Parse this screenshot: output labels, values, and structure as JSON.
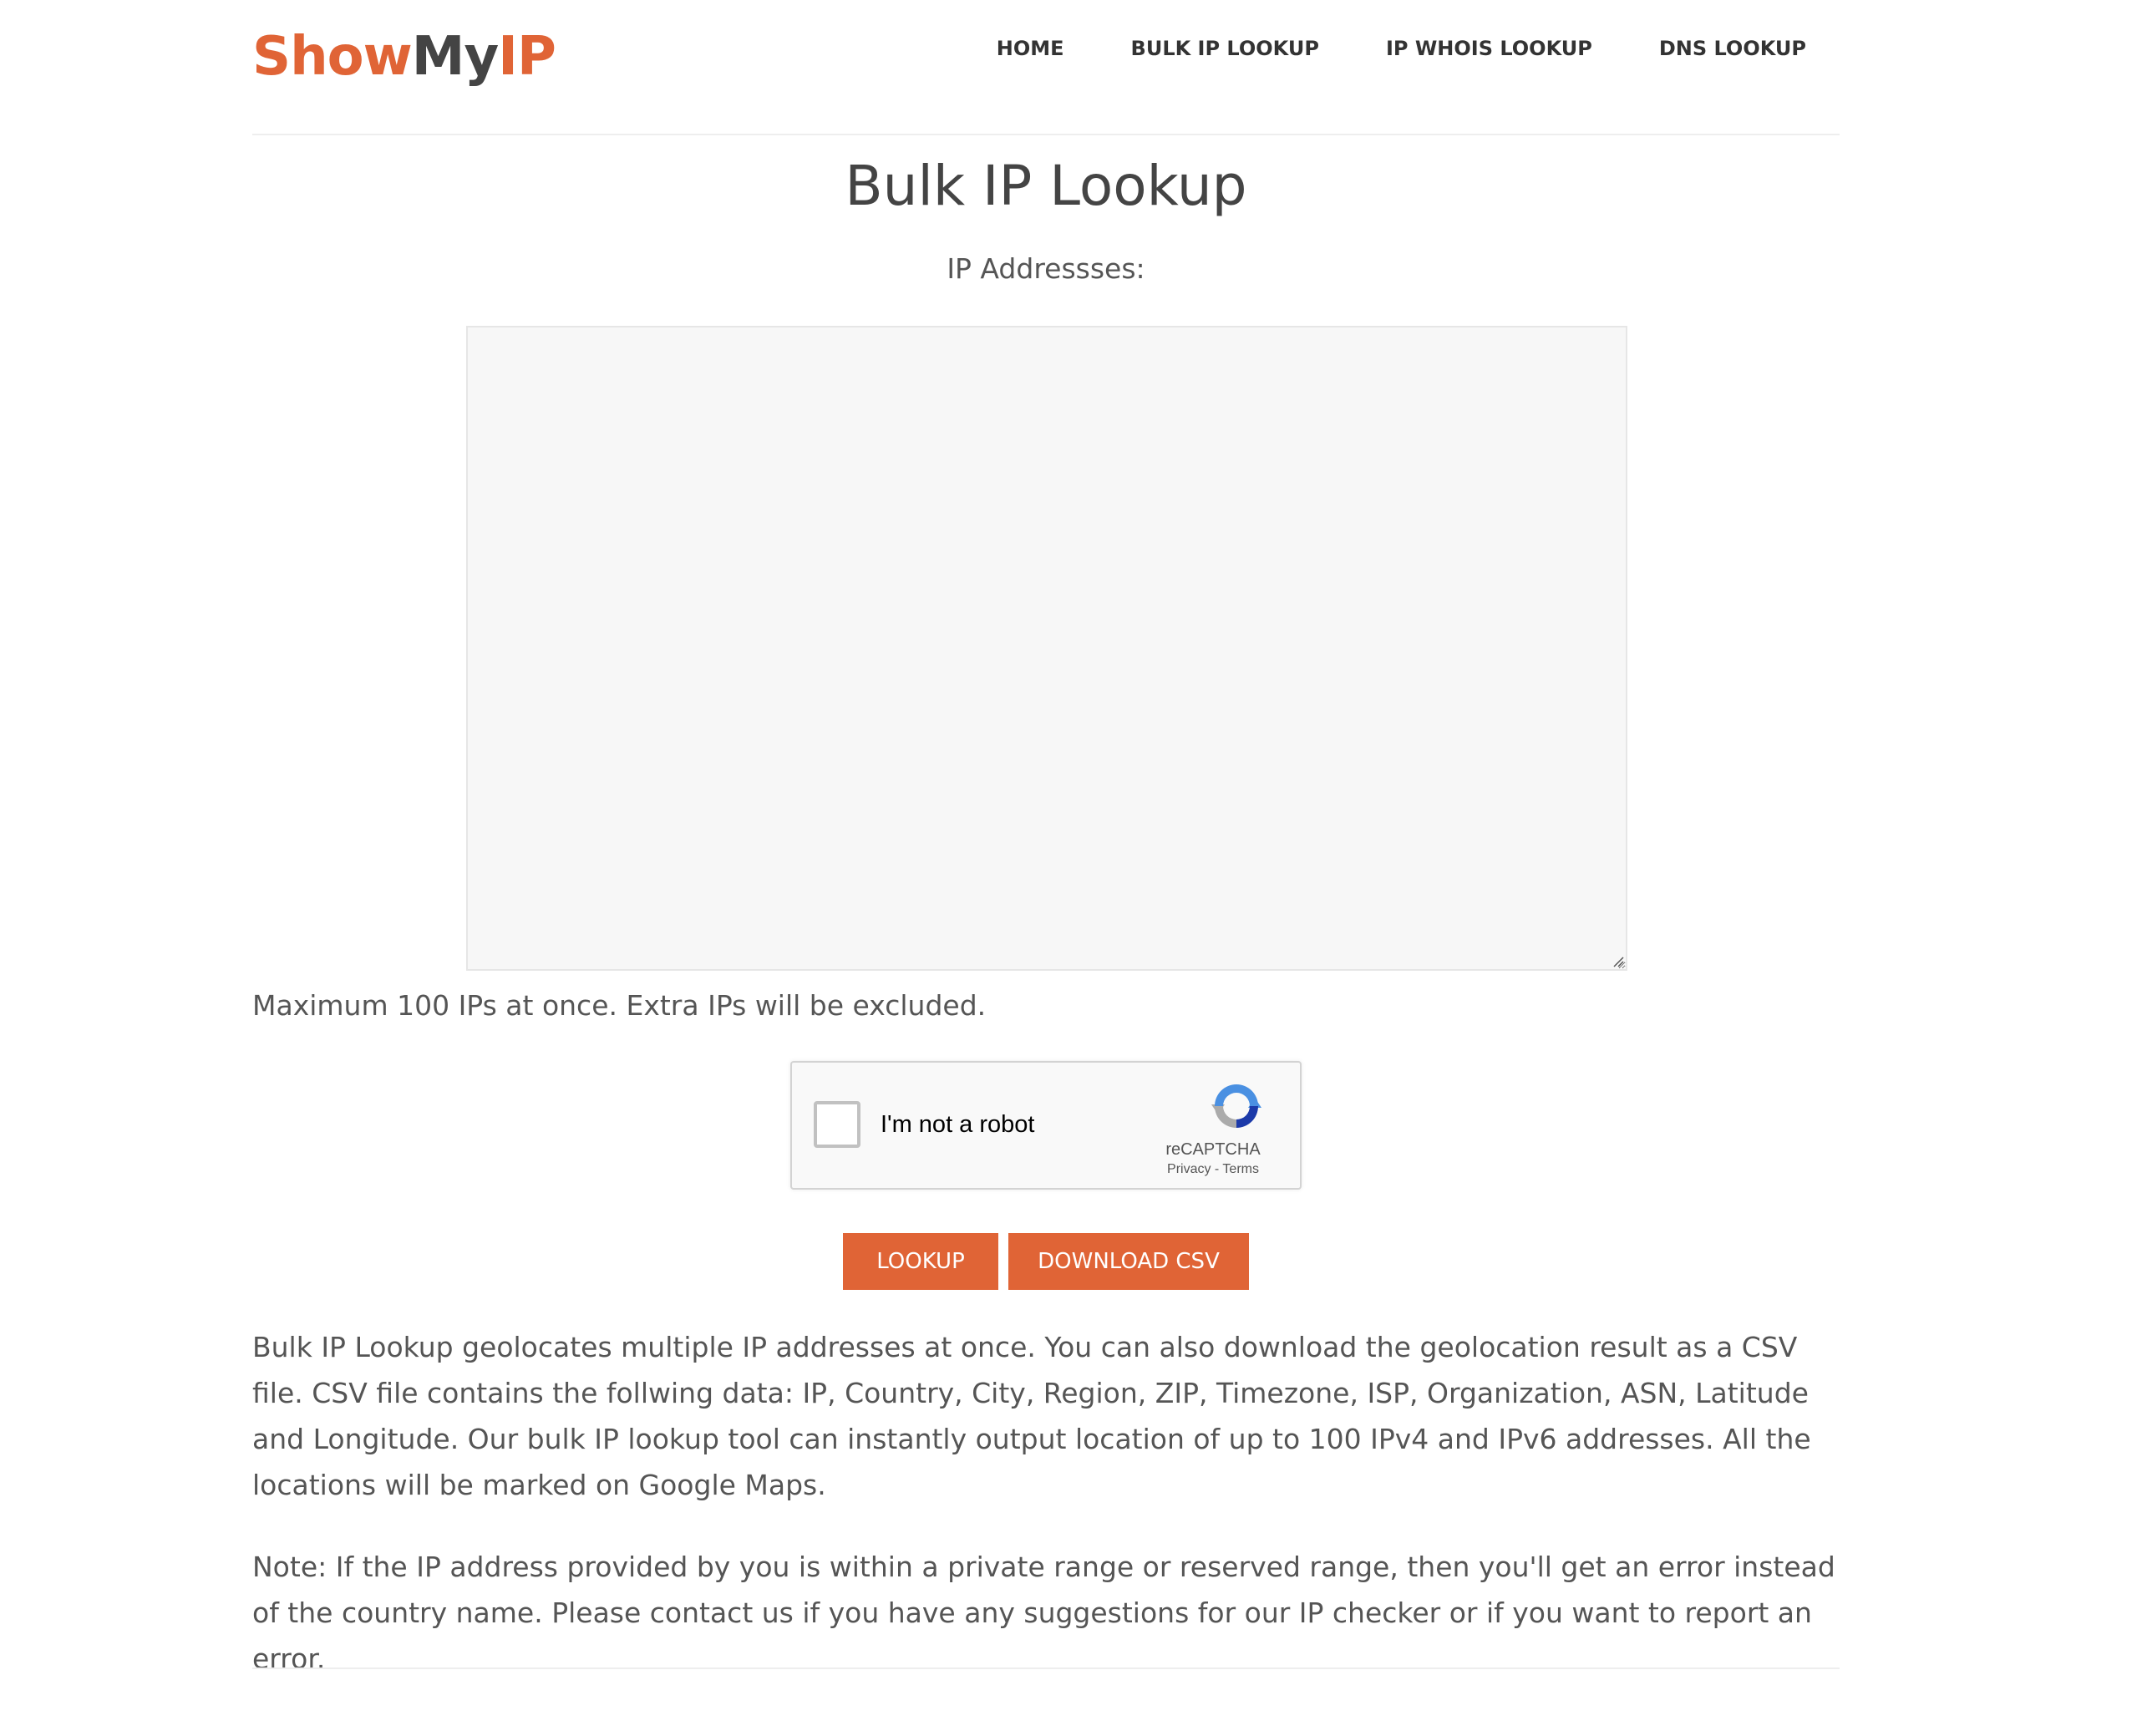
{
  "logo": {
    "part_show": "Show",
    "part_my": "My",
    "part_ip": "IP"
  },
  "nav": {
    "home": "HOME",
    "bulk_ip_lookup": "BULK IP LOOKUP",
    "ip_whois_lookup": "IP WHOIS LOOKUP",
    "dns_lookup": "DNS LOOKUP"
  },
  "main": {
    "title": "Bulk IP Lookup",
    "ip_label": "IP Addressses:",
    "textarea_value": "",
    "max_note": "Maximum 100 IPs at once. Extra IPs will be excluded."
  },
  "captcha": {
    "label": "I'm not a robot",
    "brand": "reCAPTCHA",
    "links": "Privacy - Terms",
    "checked": false
  },
  "buttons": {
    "lookup": "LOOKUP",
    "download_csv": "DOWNLOAD CSV"
  },
  "content": {
    "description": "Bulk IP Lookup geolocates multiple IP addresses at once. You can also download the geolocation result as a CSV file. CSV file contains the follwing data: IP, Country, City, Region, ZIP, Timezone, ISP, Organization, ASN, Latitude and Longitude. Our bulk IP lookup tool can instantly output location of up to 100 IPv4 and IPv6 addresses. All the locations will be marked on Google Maps.",
    "note": "Note: If the IP address provided by you is within a private range or reserved range, then you'll get an error instead of the country name. Please contact us if you have any suggestions for our IP checker or if you want to report an error."
  },
  "colors": {
    "brand": "#e06436",
    "text": "#555555",
    "heading": "#444444"
  }
}
